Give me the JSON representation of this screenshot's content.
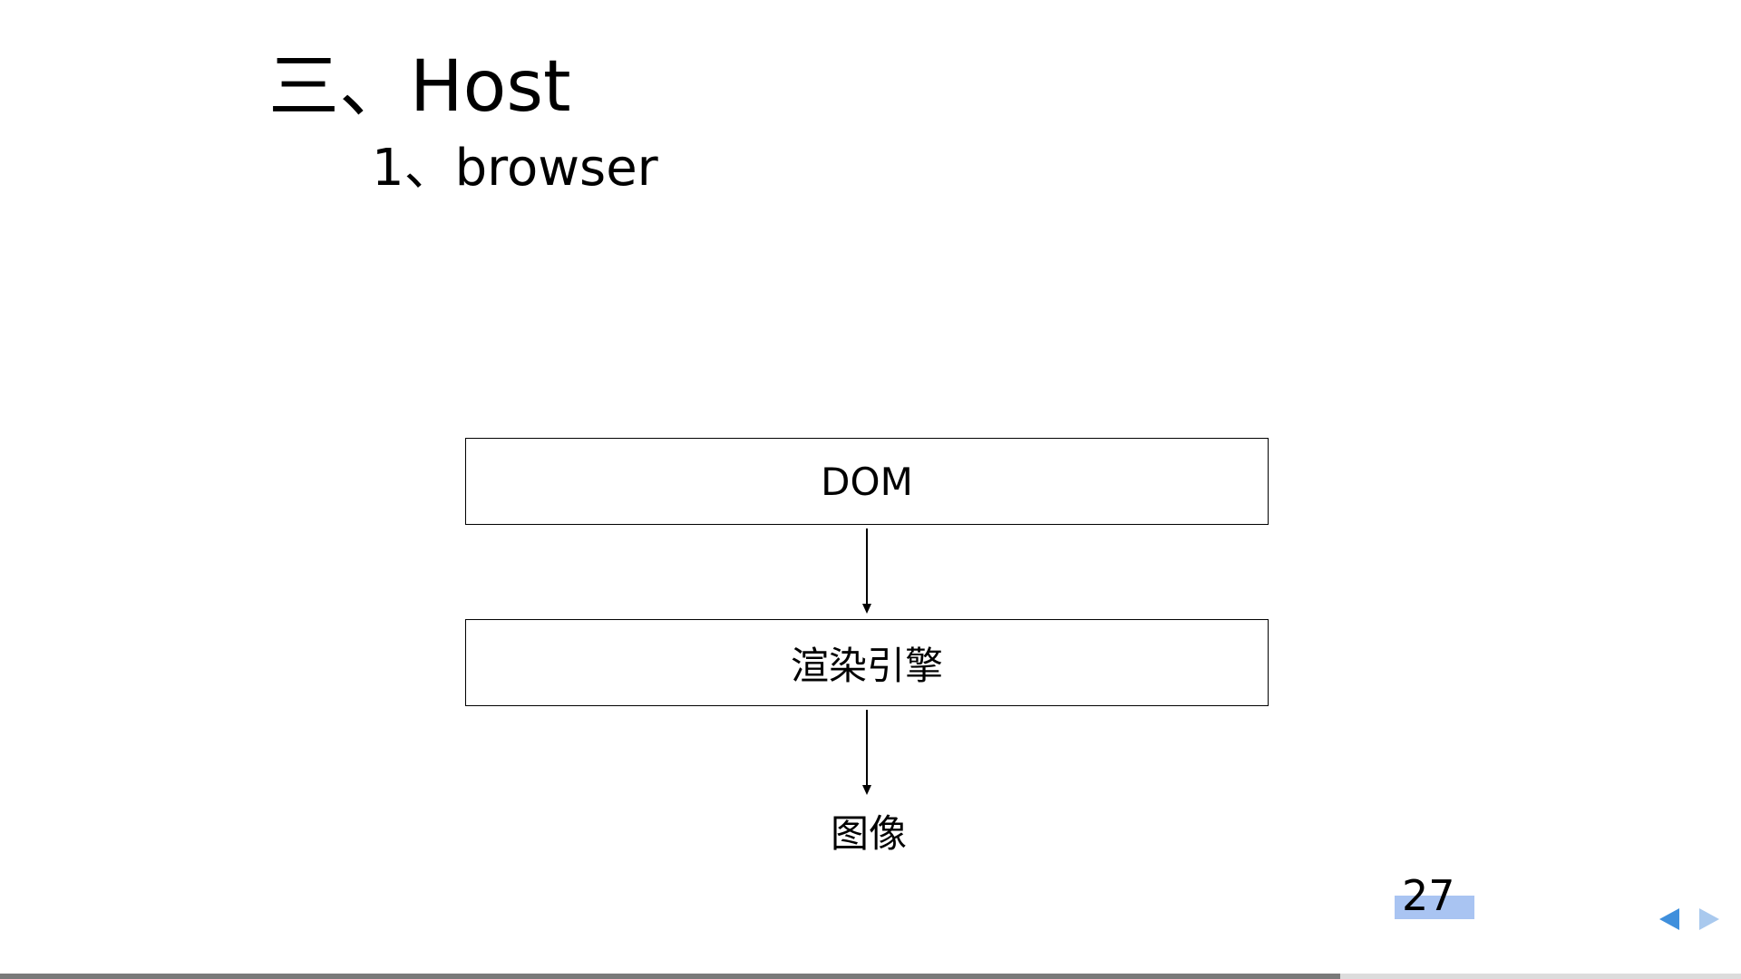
{
  "slide": {
    "title": "三、Host",
    "subtitle": "1、browser",
    "page_number": "27",
    "progress": 0.77
  },
  "diagram": {
    "nodes": [
      {
        "id": "dom",
        "label": "DOM"
      },
      {
        "id": "render-engine",
        "label": "渲染引擎"
      },
      {
        "id": "image",
        "label": "图像"
      }
    ],
    "edges": [
      {
        "from": "dom",
        "to": "render-engine"
      },
      {
        "from": "render-engine",
        "to": "image"
      }
    ]
  },
  "colors": {
    "page_number_highlight": "#a9c4f2",
    "nav_prev": "#3f8fdc",
    "nav_next": "#a9c9ee",
    "progress_fill": "#7a7a7a",
    "progress_track": "#dcdcdc"
  },
  "icons": {
    "nav_prev": "triangle-left-icon",
    "nav_next": "triangle-right-icon"
  }
}
